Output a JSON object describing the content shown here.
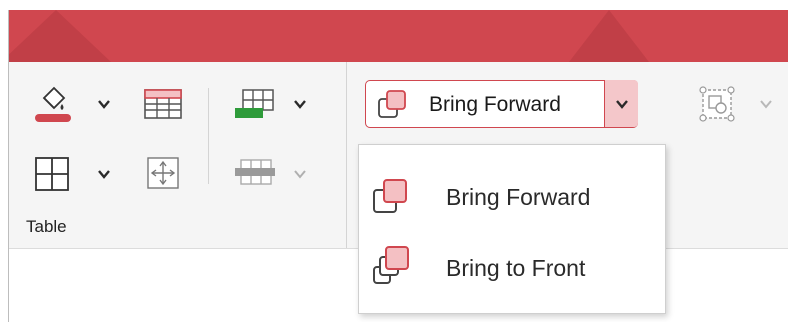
{
  "ribbon": {
    "group_label": "Table",
    "colors": {
      "accent": "#d0474f",
      "green": "#2e9b3a",
      "gray": "#9a9a9a"
    }
  },
  "arrange": {
    "combo_value": "Bring Forward",
    "menu": [
      {
        "label": "Bring Forward",
        "icon": "bring-forward-icon"
      },
      {
        "label": "Bring to Front",
        "icon": "bring-to-front-icon"
      }
    ]
  }
}
